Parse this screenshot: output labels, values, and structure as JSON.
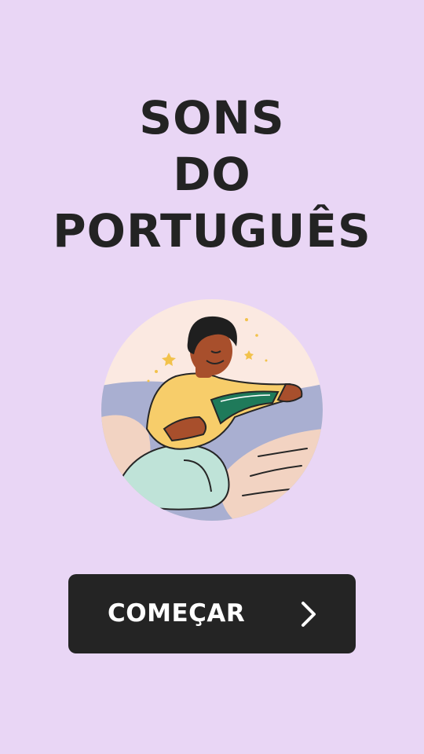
{
  "title": {
    "line1": "SONS",
    "line2": "DO",
    "line3": "PORTUGUÊS"
  },
  "illustration": {
    "subject": "person-reading-book",
    "colors": {
      "background": "#e9d6f5",
      "circle": "#fbe9e1",
      "sofa": "#a9afd1",
      "pillow": "#f2d3c2",
      "shirt": "#f7cd6a",
      "pants": "#bfe3d8",
      "skin": "#a84f2c",
      "hair": "#1f1f1f",
      "book": "#1f7a5a",
      "stars": "#f2c24b"
    }
  },
  "button": {
    "label": "COMEÇAR",
    "icon": "chevron-right-icon",
    "background": "#242424",
    "text_color": "#ffffff"
  }
}
